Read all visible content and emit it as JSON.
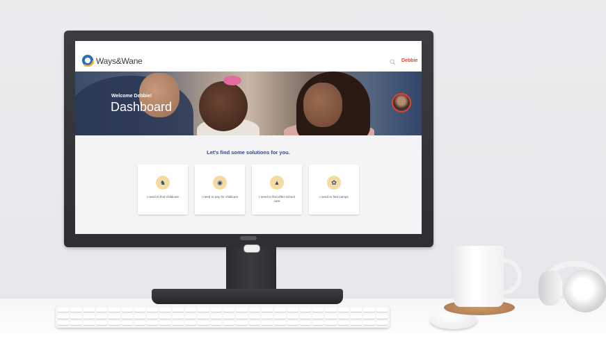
{
  "site": {
    "brand": "Ways&Wane",
    "user_name": "Debbie",
    "hero": {
      "welcome": "Welcome Debbie!",
      "title": "Dashboard"
    },
    "heading": "Let's find some solutions for you.",
    "cards": [
      {
        "label": "I need to find childcare",
        "icon": "stroller-icon"
      },
      {
        "label": "I need to pay for childcare",
        "icon": "payment-icon"
      },
      {
        "label": "I need to find after-school care",
        "icon": "school-bus-icon"
      },
      {
        "label": "I need to find camps",
        "icon": "kids-play-icon"
      }
    ]
  },
  "colors": {
    "brand_accent": "#e2432f",
    "heading_blue": "#2d4b8a",
    "icon_bg": "#f5dba1"
  }
}
